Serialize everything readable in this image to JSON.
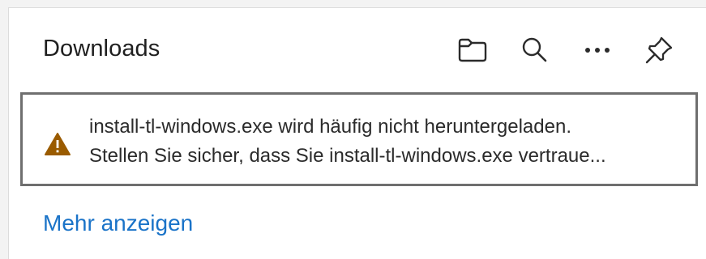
{
  "panel": {
    "title": "Downloads",
    "actions": [
      {
        "name": "folder-button",
        "icon": "folder-icon",
        "label": ""
      },
      {
        "name": "search-button",
        "icon": "search-icon",
        "label": ""
      },
      {
        "name": "more-options-button",
        "icon": "more-horizontal-icon",
        "label": ""
      },
      {
        "name": "pin-button",
        "icon": "pin-icon",
        "label": ""
      }
    ]
  },
  "download_item": {
    "icon": "warning-icon",
    "line1": "install-tl-windows.exe wird häufig nicht heruntergeladen.",
    "line2": "Stellen Sie sicher, dass Sie install-tl-windows.exe vertraue...",
    "warning_color": "#9a5b00"
  },
  "footer": {
    "more_link": "Mehr anzeigen",
    "link_color": "#1a73c8"
  }
}
